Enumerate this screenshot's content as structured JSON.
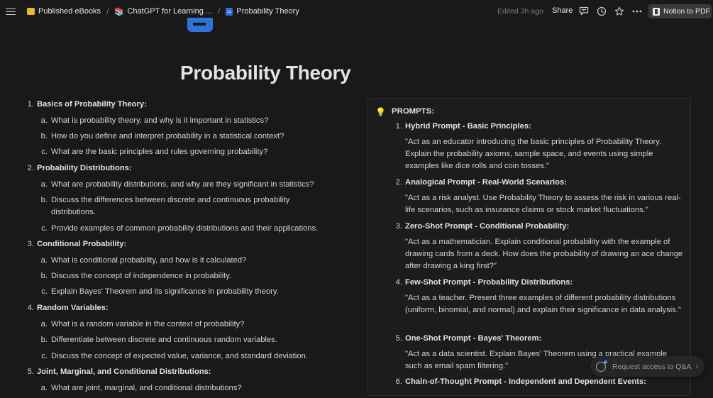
{
  "breadcrumbs": [
    {
      "label": "Published eBooks",
      "icon": "folder-icon"
    },
    {
      "label": "ChatGPT for Learning ...",
      "icon": "books-icon"
    },
    {
      "label": "Probability Theory",
      "icon": "document-icon"
    }
  ],
  "toolbar": {
    "edited": "Edited 3h ago",
    "share": "Share",
    "notion_button": "Notion to PDF"
  },
  "page": {
    "title": "Probability Theory"
  },
  "outline": [
    {
      "num": "1.",
      "title": "Basics of Probability Theory:",
      "subs": [
        {
          "letter": "a.",
          "text": "What is probability theory, and why is it important in statistics?"
        },
        {
          "letter": "b.",
          "text": "How do you define and interpret probability in a statistical context?"
        },
        {
          "letter": "c.",
          "text": "What are the basic principles and rules governing probability?"
        }
      ]
    },
    {
      "num": "2.",
      "title": "Probability Distributions:",
      "subs": [
        {
          "letter": "a.",
          "text": "What are probability distributions, and why are they significant in statistics?"
        },
        {
          "letter": "b.",
          "text": "Discuss the differences between discrete and continuous probability distributions."
        },
        {
          "letter": "c.",
          "text": "Provide examples of common probability distributions and their applications."
        }
      ]
    },
    {
      "num": "3.",
      "title": "Conditional Probability:",
      "subs": [
        {
          "letter": "a.",
          "text": "What is conditional probability, and how is it calculated?"
        },
        {
          "letter": "b.",
          "text": "Discuss the concept of independence in probability."
        },
        {
          "letter": "c.",
          "text": "Explain Bayes' Theorem and its significance in probability theory."
        }
      ]
    },
    {
      "num": "4.",
      "title": "Random Variables:",
      "subs": [
        {
          "letter": "a.",
          "text": "What is a random variable in the context of probability?"
        },
        {
          "letter": "b.",
          "text": "Differentiate between discrete and continuous random variables."
        },
        {
          "letter": "c.",
          "text": "Discuss the concept of expected value, variance, and standard deviation."
        }
      ]
    },
    {
      "num": "5.",
      "title": "Joint, Marginal, and Conditional Distributions:",
      "subs": [
        {
          "letter": "a.",
          "text": "What are joint, marginal, and conditional distributions?"
        }
      ]
    }
  ],
  "callout": {
    "icon": "lightbulb-icon",
    "heading": "PROMPTS:",
    "prompts": [
      {
        "num": "1.",
        "title": "Hybrid Prompt - Basic Principles:",
        "text": "\"Act as an educator introducing the basic principles of Probability Theory. Explain the probability axioms, sample space, and events using simple examples like dice rolls and coin tosses.\""
      },
      {
        "num": "2.",
        "title": "Analogical Prompt - Real-World Scenarios:",
        "text": "\"Act as a risk analyst. Use Probability Theory to assess the risk in various real-life scenarios, such as insurance claims or stock market fluctuations.\""
      },
      {
        "num": "3.",
        "title": "Zero-Shot Prompt - Conditional Probability:",
        "text": "\"Act as a mathematician. Explain conditional probability with the example of drawing cards from a deck. How does the probability of drawing an ace change after drawing a king first?\""
      },
      {
        "num": "4.",
        "title": "Few-Shot Prompt - Probability Distributions:",
        "text": "\"Act as a teacher. Present three examples of different probability distributions (uniform, binomial, and normal) and explain their significance in data analysis.\""
      },
      {
        "num": "5.",
        "title": "One-Shot Prompt - Bayes' Theorem:",
        "text": "\"Act as a data scientist. Explain Bayes' Theorem using a practical example such as email spam filtering.\""
      },
      {
        "num": "6.",
        "title": "Chain-of-Thought Prompt - Independent and Dependent Events:",
        "text": ""
      }
    ]
  },
  "floating": {
    "qa_label": "Request access to Q&A"
  }
}
